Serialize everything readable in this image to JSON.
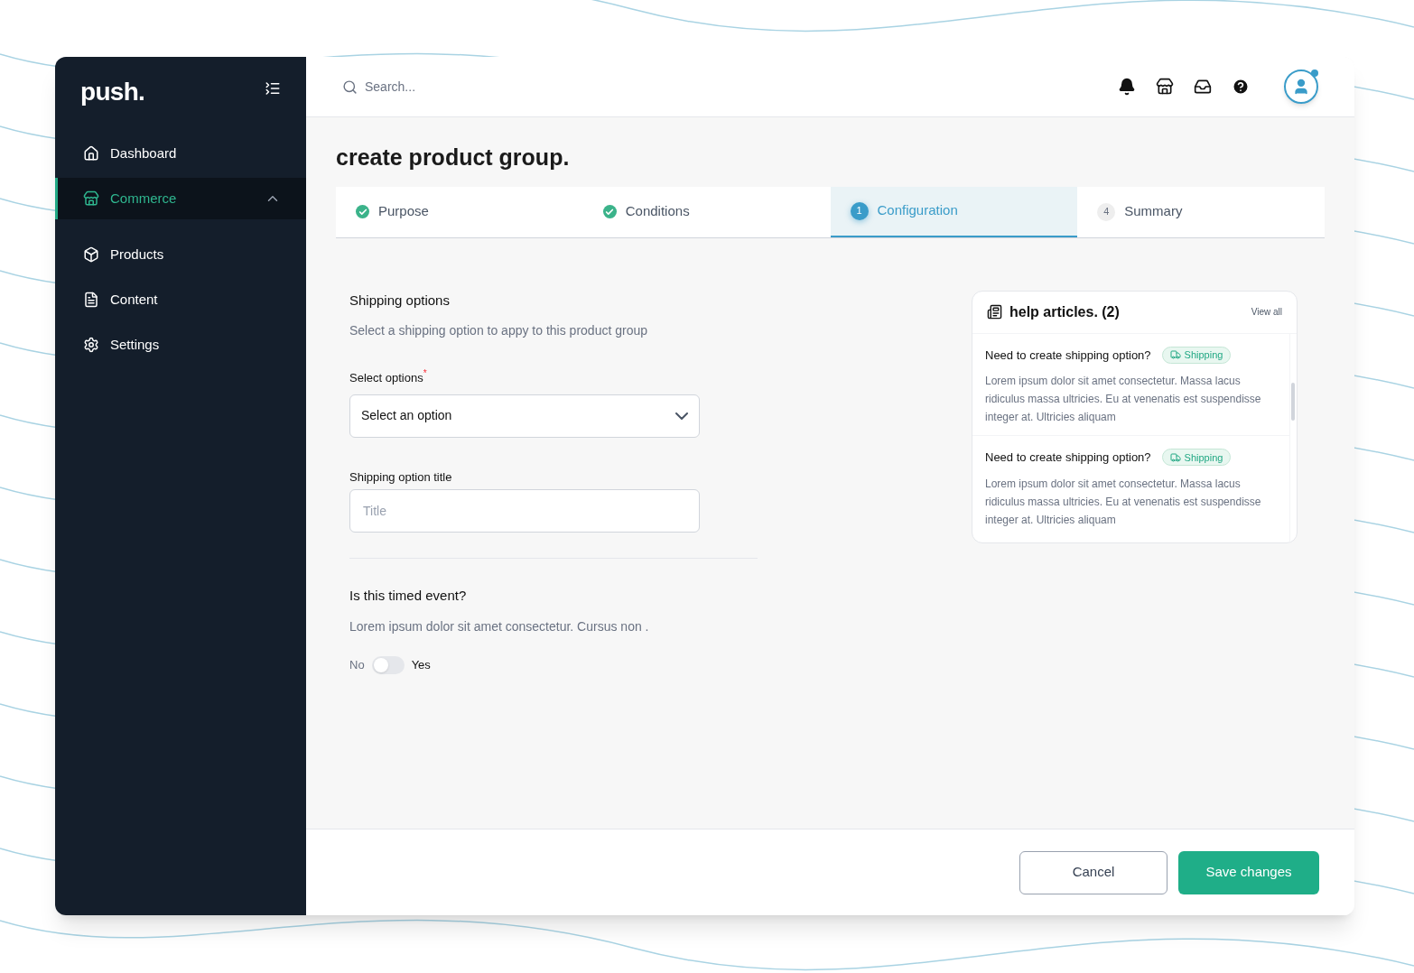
{
  "sidebar": {
    "logo": "push.",
    "items": [
      {
        "label": "Dashboard",
        "selected": false
      },
      {
        "label": "Commerce",
        "selected": true,
        "expanded": true,
        "children": [
          {
            "label": "Products",
            "selected": false
          },
          {
            "label": "Content",
            "selected": false
          },
          {
            "label": "Settings",
            "selected": false
          }
        ]
      }
    ]
  },
  "topbar": {
    "search": {
      "placeholder": "Search..."
    }
  },
  "page": {
    "title": "create product group.",
    "steps": [
      {
        "label": "Purpose",
        "kind": "complete",
        "selected": false
      },
      {
        "label": "Conditions",
        "kind": "complete",
        "selected": false
      },
      {
        "label": "Configuration",
        "kind": "numbered",
        "number": "1",
        "selected": true
      },
      {
        "label": "Summary",
        "kind": "numbered",
        "number": "4",
        "selected": false
      }
    ],
    "shipping": {
      "heading": "Shipping options",
      "description": "Select a shipping option to appy to this product group",
      "select": {
        "label": "Select options",
        "required_mark": "*",
        "value": "Select an option"
      },
      "title_field": {
        "label": "Shipping option title",
        "placeholder": "Title"
      }
    },
    "timed": {
      "heading": "Is this timed event?",
      "description": "Lorem ipsum dolor sit amet consectetur. Cursus non .",
      "off_label": "No",
      "on_label": "Yes",
      "on": false
    },
    "help": {
      "title": "help articles. (2)",
      "view_all": "View all",
      "articles": [
        {
          "title": "Need to create shipping option?",
          "tag": "Shipping",
          "body": "Lorem ipsum dolor sit amet consectetur. Massa lacus ridiculus massa ultricies. Eu at venenatis est suspendisse integer at. Ultricies aliquam"
        },
        {
          "title": "Need to create shipping option?",
          "tag": "Shipping",
          "body": "Lorem ipsum dolor sit amet consectetur. Massa lacus ridiculus massa ultricies. Eu at venenatis est suspendisse integer at. Ultricies aliquam"
        }
      ]
    }
  },
  "footer": {
    "buttons": [
      {
        "label": "Cancel",
        "kind": "secondary"
      },
      {
        "label": "Save changes",
        "kind": "primary"
      }
    ]
  }
}
